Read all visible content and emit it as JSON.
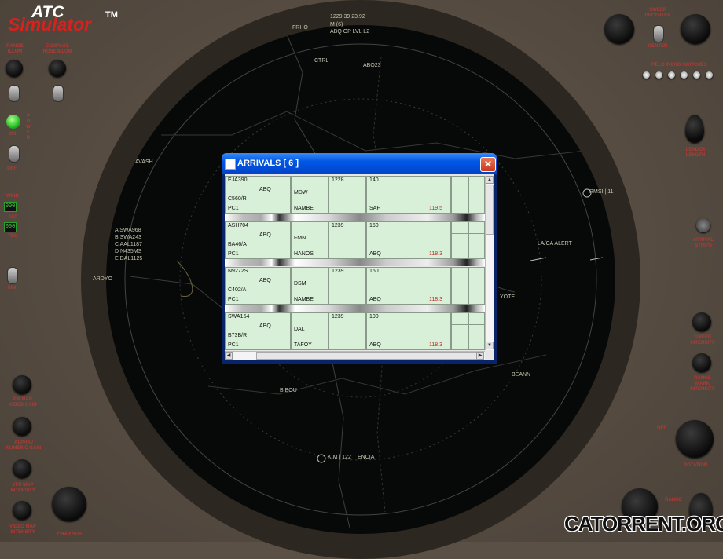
{
  "app": {
    "logo_top": "ATC",
    "logo_bottom": "Simulator",
    "tm": "TM"
  },
  "left_panel": {
    "range_illum": "RANGE\nILLUM",
    "compass_illum": "COMPASS\nROSE ILLUM",
    "power": "P\nO\nW\nE\nR",
    "on": "ON",
    "off": "OFF",
    "wind": "WIND",
    "wind_value": "000",
    "alt": "ALT",
    "alt_value": "000",
    "tdc": "TDC",
    "sim": "SIM",
    "fm_gain": "FM MAP\nVIDEO GAIN",
    "alpha_gain": "ALPHA /\nNUMERIC GAIN",
    "vfr_map": "VFR MAP\nINTENSITY",
    "video_map": "VIDEO MAP\nINTENSITY",
    "char_size": "CHAR SIZE"
  },
  "right_panel": {
    "sweep_decenter": "SWEEP\nDECENTER",
    "center": "CENTER",
    "field_inbnd": "FIELD INBND SWITCHES",
    "leader_length": "LEADER\nLENGTH",
    "arrival_strips": "ARRIVAL\nSTRIPS",
    "sweep_intensity": "SWEEP\nINTENSITY",
    "range_mark": "RANGE\nMARK\nINTENSITY",
    "off": "OFF",
    "rotation": "ROTATION",
    "range": "RANGE"
  },
  "radar": {
    "clock": "1229:39 23.92",
    "m_info": "M (6)",
    "level": "ABQ OP LVL L2",
    "ctrl": "CTRL",
    "fixes": [
      "FRHO",
      "ABQ23",
      "AVASH",
      "RMSI | 11",
      "ARDYO",
      "YOTE",
      "BEANN",
      "BIBOU",
      "ENCIA",
      "KIM | 122"
    ],
    "alert": "LA/CA ALERT",
    "traffic": [
      "A SWA968",
      "B SWA243",
      "C AAL1187",
      "D N435MS",
      "E DAL1125"
    ]
  },
  "window": {
    "title": "ARRIVALS [ 6 ]",
    "close": "✕",
    "strips": [
      {
        "callsign": "EJA390",
        "dest": "ABQ",
        "type": "C560/R",
        "rule": "PC1",
        "from": "MDW",
        "fix": "NAMBE",
        "time": "1228",
        "alt": "140",
        "gate": "SAF",
        "freq": "119.5"
      },
      {
        "callsign": "ASH704",
        "dest": "ABQ",
        "type": "BA46/A",
        "rule": "PC1",
        "from": "FMN",
        "fix": "HANOS",
        "time": "1239",
        "alt": "150",
        "gate": "ABQ",
        "freq": "118.3"
      },
      {
        "callsign": "N9272S",
        "dest": "ABQ",
        "type": "C402/A",
        "rule": "PC1",
        "from": "DSM",
        "fix": "NAMBE",
        "time": "1239",
        "alt": "160",
        "gate": "ABQ",
        "freq": "118.3"
      },
      {
        "callsign": "SWA154",
        "dest": "ABQ",
        "type": "B73B/R",
        "rule": "PC1",
        "from": "DAL",
        "fix": "TAFOY",
        "time": "1239",
        "alt": "100",
        "gate": "ABQ",
        "freq": "118.3"
      }
    ]
  },
  "watermark": "CATORRENT.ORG"
}
